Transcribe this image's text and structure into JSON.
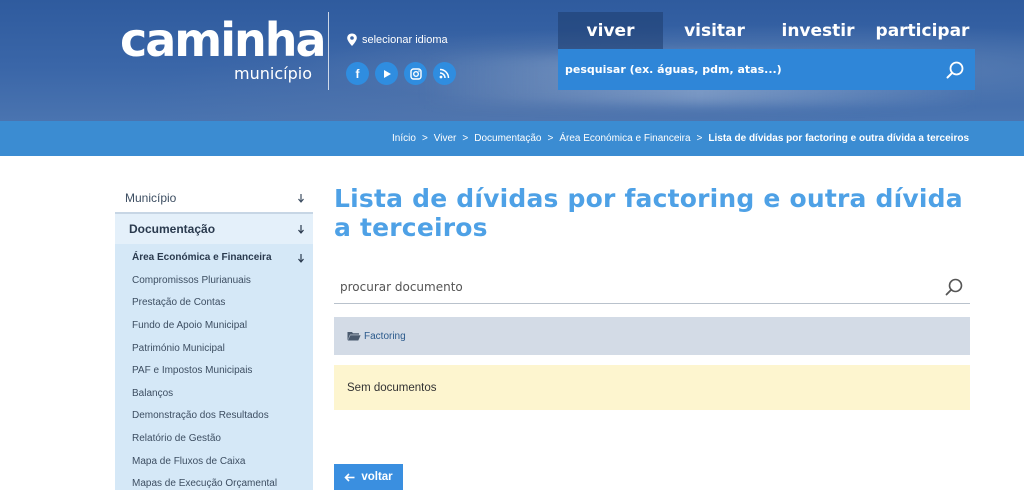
{
  "header": {
    "logo_main": "caminha",
    "logo_sub": "município",
    "language_label": "selecionar idioma",
    "socials": [
      {
        "name": "facebook",
        "glyph": "f",
        "icon": "facebook-icon"
      },
      {
        "name": "youtube",
        "glyph": "",
        "icon": "youtube-icon"
      },
      {
        "name": "instagram",
        "glyph": "",
        "icon": "instagram-icon"
      },
      {
        "name": "rss",
        "glyph": "",
        "icon": "rss-icon"
      }
    ],
    "nav": [
      {
        "label": "viver",
        "active": true
      },
      {
        "label": "visitar",
        "active": false
      },
      {
        "label": "investir",
        "active": false
      },
      {
        "label": "participar",
        "active": false
      }
    ],
    "search_placeholder": "pesquisar (ex. águas, pdm, atas...)"
  },
  "breadcrumb": {
    "items": [
      "Início",
      "Viver",
      "Documentação",
      "Área Económica e Financeira",
      "Lista de dívidas por factoring e outra dívida a terceiros"
    ]
  },
  "sidebar": {
    "level1": "Município",
    "level2": "Documentação",
    "level3": "Área Económica e Financeira",
    "items": [
      "Compromissos Plurianuais",
      "Prestação de Contas",
      "Fundo de Apoio Municipal",
      "Património Municipal",
      "PAF e Impostos Municipais",
      "Balanços",
      "Demonstração dos Resultados",
      "Relatório de Gestão",
      "Mapa de Fluxos de Caixa",
      "Mapas de Execução Orçamental"
    ]
  },
  "main": {
    "title": "Lista de dívidas por factoring e outra dívida a terceiros",
    "search_placeholder": "procurar documento",
    "folder_label": "Factoring",
    "empty_message": "Sem documentos",
    "back_label": "voltar"
  },
  "colors": {
    "accent": "#4ea1e6",
    "header_blue": "#2f5b9e",
    "breadcrumb_bar": "#3b8cd2",
    "search_top": "#2f86d8",
    "folder_bg": "#d3dbe6",
    "empty_bg": "#fdf5cf",
    "sidebar_sub_bg": "#d5e8f7"
  }
}
